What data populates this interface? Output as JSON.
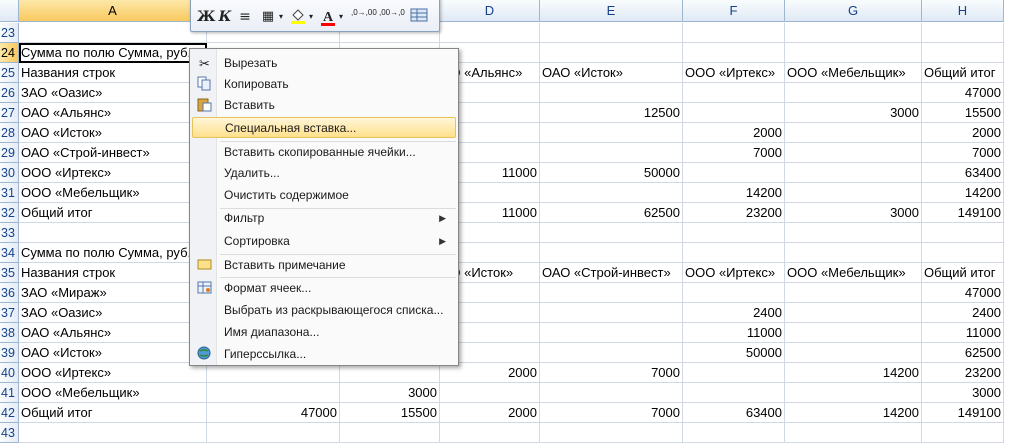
{
  "columns": [
    "A",
    "B",
    "C",
    "D",
    "E",
    "F",
    "G",
    "H"
  ],
  "rows": [
    {
      "n": "23",
      "cells": {}
    },
    {
      "n": "24",
      "cells": {
        "A": "Сумма по полю Сумма, руб."
      }
    },
    {
      "n": "25",
      "cells": {
        "A": "Названия строк",
        "D": "АО «Альянс»",
        "E": "ОАО «Исток»",
        "F": "ООО «Иртекс»",
        "G": "ООО «Мебельщик»",
        "H": "Общий итог"
      }
    },
    {
      "n": "26",
      "cells": {
        "A": "ЗАО «Оазис»",
        "H": "47000"
      }
    },
    {
      "n": "27",
      "cells": {
        "A": "ОАО «Альянс»",
        "E": "12500",
        "G": "3000",
        "H": "15500"
      }
    },
    {
      "n": "28",
      "cells": {
        "A": "ОАО «Исток»",
        "F": "2000",
        "H": "2000"
      }
    },
    {
      "n": "29",
      "cells": {
        "A": "ОАО «Строй-инвест»",
        "F": "7000",
        "H": "7000"
      }
    },
    {
      "n": "30",
      "cells": {
        "A": "ООО «Иртекс»",
        "D": "11000",
        "E": "50000",
        "H": "63400"
      }
    },
    {
      "n": "31",
      "cells": {
        "A": "ООО «Мебельщик»",
        "F": "14200",
        "H": "14200"
      }
    },
    {
      "n": "32",
      "cells": {
        "A": "Общий итог",
        "D": "11000",
        "E": "62500",
        "F": "23200",
        "G": "3000",
        "H": "149100"
      }
    },
    {
      "n": "33",
      "cells": {}
    },
    {
      "n": "34",
      "cells": {
        "A": "Сумма по полю Сумма, руб."
      }
    },
    {
      "n": "35",
      "cells": {
        "A": "Названия строк",
        "D": "АО «Исток»",
        "E": "ОАО «Строй-инвест»",
        "F": "ООО «Иртекс»",
        "G": "ООО «Мебельщик»",
        "H": "Общий итог"
      }
    },
    {
      "n": "36",
      "cells": {
        "A": "ЗАО «Мираж»",
        "H": "47000"
      }
    },
    {
      "n": "37",
      "cells": {
        "A": "ЗАО «Оазис»",
        "F": "2400",
        "H": "2400"
      }
    },
    {
      "n": "38",
      "cells": {
        "A": "ОАО «Альянс»",
        "F": "11000",
        "H": "11000"
      }
    },
    {
      "n": "39",
      "cells": {
        "A": "ОАО «Исток»",
        "F": "50000",
        "H": "62500"
      }
    },
    {
      "n": "40",
      "cells": {
        "A": "ООО «Иртекс»",
        "D": "2000",
        "E": "7000",
        "G": "14200",
        "H": "23200"
      }
    },
    {
      "n": "41",
      "cells": {
        "A": "ООО «Мебельщик»",
        "C": "3000",
        "H": "3000"
      }
    },
    {
      "n": "42",
      "cells": {
        "A": "Общий итог",
        "B": "47000",
        "C": "15500",
        "D": "2000",
        "E": "7000",
        "F": "63400",
        "G": "14200",
        "H": "149100"
      }
    },
    {
      "n": "43",
      "cells": {}
    }
  ],
  "minibar": {
    "bold": "Ж",
    "italic": "К",
    "align": "≡",
    "borders": "▦",
    "fill_icon": "fill-color-icon",
    "font_color": "А",
    "fill_color": "#ffff00",
    "text_color": "#ff0000",
    "inc_decimal": ",0→,00",
    "dec_decimal": ",00→,0",
    "format": "format-icon"
  },
  "menu": {
    "cut": "Вырезать",
    "copy": "Копировать",
    "paste": "Вставить",
    "paste_special": "Специальная вставка...",
    "insert_copied": "Вставить скопированные ячейки...",
    "delete": "Удалить...",
    "clear": "Очистить содержимое",
    "filter": "Фильтр",
    "sort": "Сортировка",
    "insert_comment": "Вставить примечание",
    "format_cells": "Формат ячеек...",
    "pick_list": "Выбрать из раскрывающегося списка...",
    "name_range": "Имя диапазона...",
    "hyperlink": "Гиперссылка..."
  }
}
